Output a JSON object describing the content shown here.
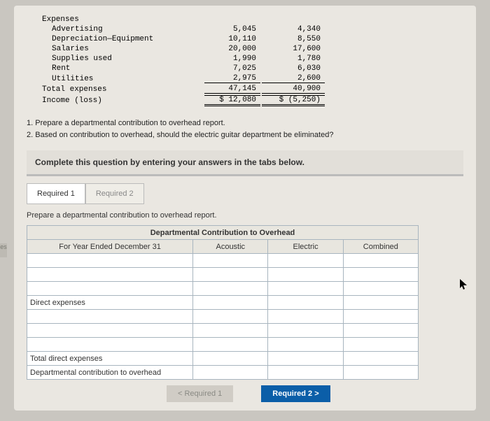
{
  "expenses": {
    "header": "Expenses",
    "rows": [
      {
        "label": "Advertising",
        "c1": "5,045",
        "c2": "4,340"
      },
      {
        "label": "Depreciation—Equipment",
        "c1": "10,110",
        "c2": "8,550"
      },
      {
        "label": "Salaries",
        "c1": "20,000",
        "c2": "17,600"
      },
      {
        "label": "Supplies used",
        "c1": "1,990",
        "c2": "1,780"
      },
      {
        "label": "Rent",
        "c1": "7,025",
        "c2": "6,030"
      },
      {
        "label": "Utilities",
        "c1": "2,975",
        "c2": "2,600"
      }
    ],
    "total": {
      "label": "Total expenses",
      "c1": "47,145",
      "c2": "40,900"
    },
    "income": {
      "label": "Income (loss)",
      "c1": "$ 12,080",
      "c2": "$ (5,250)"
    }
  },
  "questions": {
    "q1": "1. Prepare a departmental contribution to overhead report.",
    "q2": "2. Based on contribution to overhead, should the electric guitar department be eliminated?"
  },
  "prompt": "Complete this question by entering your answers in the tabs below.",
  "tabs": {
    "t1": "Required 1",
    "t2": "Required 2"
  },
  "instruction": "Prepare a departmental contribution to overhead report.",
  "worksheet": {
    "title": "Departmental Contribution to Overhead",
    "period": "For Year Ended December 31",
    "col1": "Acoustic",
    "col2": "Electric",
    "col3": "Combined",
    "direct": "Direct expenses",
    "total_direct": "Total direct expenses",
    "contrib": "Departmental contribution to overhead"
  },
  "nav": {
    "prev": "<  Required 1",
    "next": "Required 2  >"
  },
  "stub": "es",
  "cursor": "➤"
}
